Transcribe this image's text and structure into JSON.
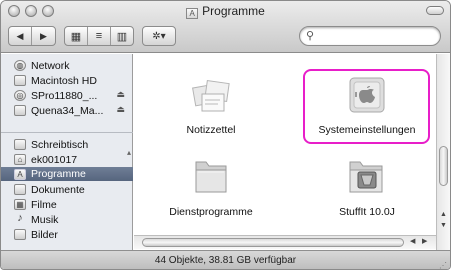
{
  "window": {
    "title": "Programme",
    "title_icon": "folder-app-icon"
  },
  "toolbar": {
    "back_label": "◀",
    "forward_label": "▶",
    "view_icon_label": "▦",
    "view_list_label": "≡",
    "view_column_label": "▥",
    "action_label": "✲▾",
    "search_placeholder": ""
  },
  "sidebar": {
    "items": [
      {
        "label": "Network",
        "icon": "network-icon",
        "glyph": "◍"
      },
      {
        "label": "Macintosh HD",
        "icon": "hard-drive-icon",
        "glyph": "▭"
      },
      {
        "label": "SPro11880_...",
        "icon": "cd-icon",
        "glyph": "◎",
        "eject": "⏏"
      },
      {
        "label": "Quena34_Ma...",
        "icon": "disk-icon",
        "glyph": "▯",
        "eject": "⏏"
      },
      {
        "label": "Schreibtisch",
        "icon": "desktop-icon",
        "glyph": "▤"
      },
      {
        "label": "ek001017",
        "icon": "home-icon",
        "glyph": "⌂"
      },
      {
        "label": "Programme",
        "icon": "applications-icon",
        "glyph": "A"
      },
      {
        "label": "Dokumente",
        "icon": "documents-icon",
        "glyph": "▯"
      },
      {
        "label": "Filme",
        "icon": "movies-icon",
        "glyph": "▦"
      },
      {
        "label": "Musik",
        "icon": "music-icon",
        "glyph": "♪"
      },
      {
        "label": "Bilder",
        "icon": "pictures-icon",
        "glyph": "▧"
      }
    ]
  },
  "content": {
    "items": [
      {
        "label": "Notizzettel",
        "icon": "stickies-icon"
      },
      {
        "label": "Systemeinstellungen",
        "icon": "system-preferences-icon",
        "highlighted": true
      },
      {
        "label": "Dienstprogramme",
        "icon": "utilities-folder-icon"
      },
      {
        "label": "StuffIt 10.0J",
        "icon": "stuffit-folder-icon"
      }
    ]
  },
  "status": {
    "text": "44 Objekte, 38.81 GB verfügbar"
  },
  "colors": {
    "highlight": "#e81ec9",
    "sidebar_selected": "#5d6c85",
    "sidebar_bg": "#e8ebf0"
  }
}
